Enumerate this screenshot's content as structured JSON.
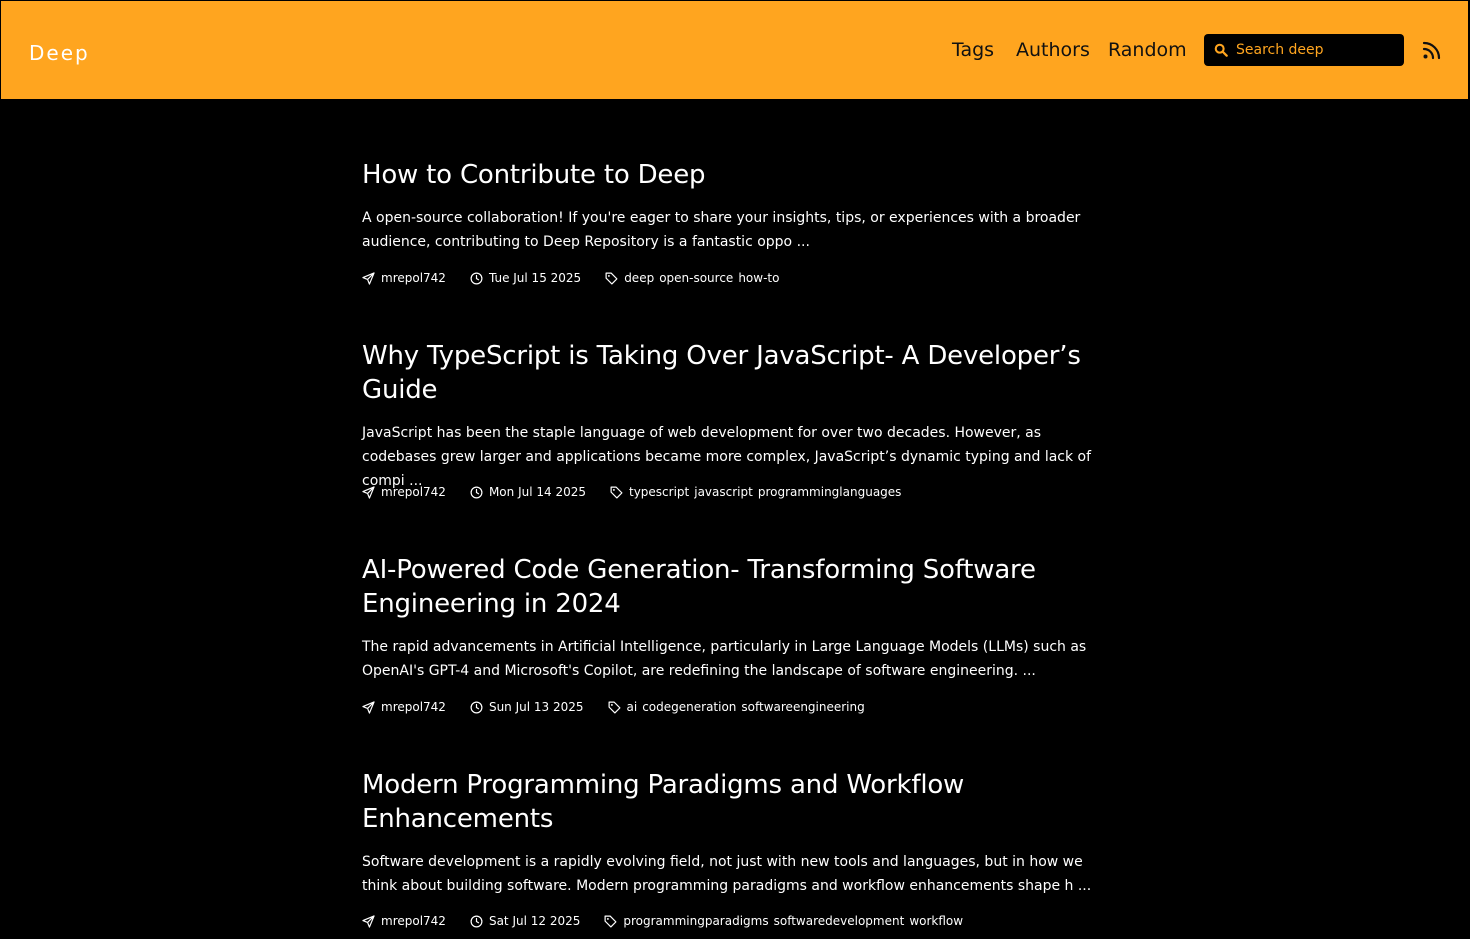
{
  "header": {
    "brand": "Deep",
    "nav": {
      "tags": "Tags",
      "authors": "Authors",
      "random": "Random"
    },
    "search": {
      "placeholder": "Search deep",
      "value": ""
    },
    "rss_icon": "rss-icon",
    "accent": "#ffa51f"
  },
  "posts": [
    {
      "title": "How to Contribute to Deep",
      "excerpt": "A open-source collaboration! If you're eager to share your insights, tips, or experiences with a broader audience, contributing to Deep Repository is a fantastic oppo ...",
      "author": "mrepol742",
      "date": "Tue Jul 15 2025",
      "tags": [
        "deep",
        "open-source",
        "how-to"
      ]
    },
    {
      "title": "Why TypeScript is Taking Over JavaScript- A Developer’s Guide",
      "excerpt": "JavaScript has been the staple language of web development for over two decades. However, as codebases grew larger and applications became more complex, JavaScript’s dynamic typing and lack of compi ...",
      "author": "mrepol742",
      "date": "Mon Jul 14 2025",
      "tags": [
        "typescript",
        "javascript",
        "programminglanguages"
      ]
    },
    {
      "title": "AI-Powered Code Generation- Transforming Software Engineering in 2024",
      "excerpt": "The rapid advancements in Artificial Intelligence, particularly in Large Language Models (LLMs) such as OpenAI's GPT-4 and Microsoft's Copilot, are redefining the landscape of software engineering. ...",
      "author": "mrepol742",
      "date": "Sun Jul 13 2025",
      "tags": [
        "ai",
        "codegeneration",
        "softwareengineering"
      ]
    },
    {
      "title": "Modern Programming Paradigms and Workflow Enhancements",
      "excerpt": "Software development is a rapidly evolving field, not just with new tools and languages, but in how we think about building software. Modern programming paradigms and workflow enhancements shape h ...",
      "author": "mrepol742",
      "date": "Sat Jul 12 2025",
      "tags": [
        "programmingparadigms",
        "softwaredevelopment",
        "workflow"
      ]
    }
  ]
}
